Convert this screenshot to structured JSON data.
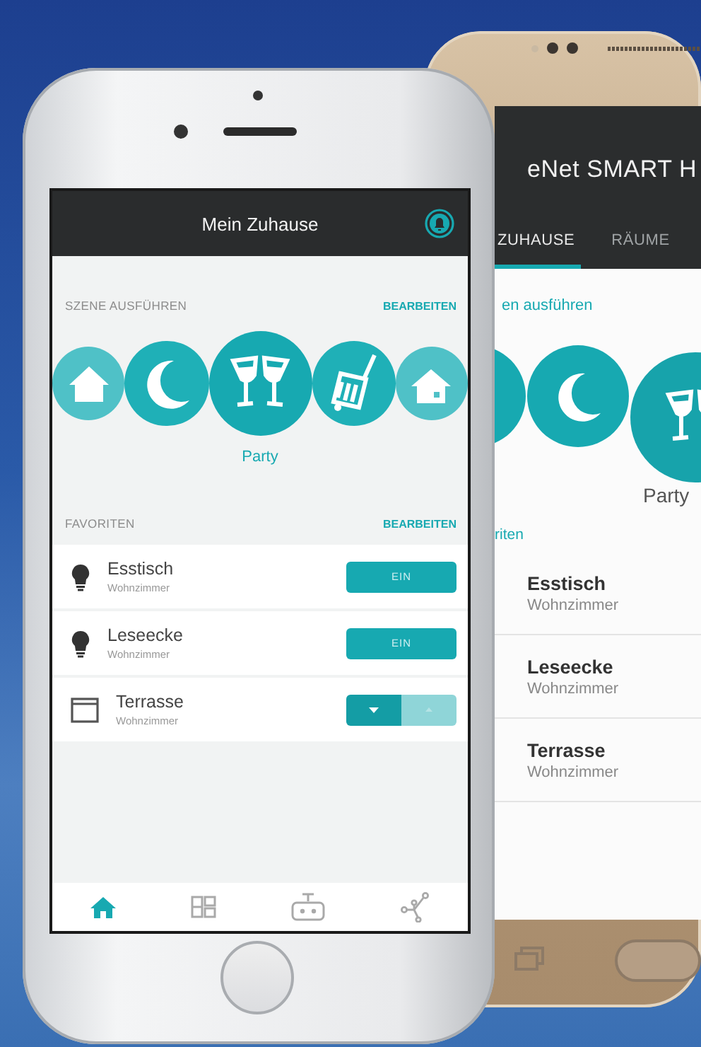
{
  "back_phone": {
    "title": "eNet SMART H",
    "tabs": [
      {
        "label": "ZUHAUSE",
        "selected": true
      },
      {
        "label": "RÄUME",
        "selected": false
      }
    ],
    "scene_label": "en ausführen",
    "scenes": [
      {
        "selected": false
      },
      {
        "kind": "night",
        "selected": false
      },
      {
        "kind": "party",
        "selected": true
      }
    ],
    "scene_caption": "Party",
    "favorites_label": "riten",
    "favorites": [
      {
        "name": "Esstisch",
        "room": "Wohnzimmer"
      },
      {
        "name": "Leseecke",
        "room": "Wohnzimmer"
      },
      {
        "name": "Terrasse",
        "room": "Wohnzimmer"
      }
    ]
  },
  "front_phone": {
    "title": "Mein Zuhause",
    "scene_label": "SZENE AUSFÜHREN",
    "scene_edit": "BEARBEITEN",
    "scenes": [
      {
        "kind": "home",
        "selected": false
      },
      {
        "kind": "night",
        "selected": false
      },
      {
        "kind": "party",
        "selected": true
      },
      {
        "kind": "travel",
        "selected": false
      },
      {
        "kind": "away",
        "selected": false
      }
    ],
    "scene_caption": "Party",
    "favorites_label": "FAVORITEN",
    "favorites_edit": "BEARBEITEN",
    "favorites": [
      {
        "kind": "light",
        "name": "Esstisch",
        "room": "Wohnzimmer",
        "button": "EIN"
      },
      {
        "kind": "light",
        "name": "Leseecke",
        "room": "Wohnzimmer",
        "button": "EIN"
      },
      {
        "kind": "blind",
        "name": "Terrasse",
        "room": "Wohnzimmer"
      }
    ],
    "nav": [
      {
        "kind": "home",
        "selected": true
      },
      {
        "kind": "dashboard",
        "selected": false
      },
      {
        "kind": "robot",
        "selected": false
      },
      {
        "kind": "network",
        "selected": false
      }
    ]
  }
}
